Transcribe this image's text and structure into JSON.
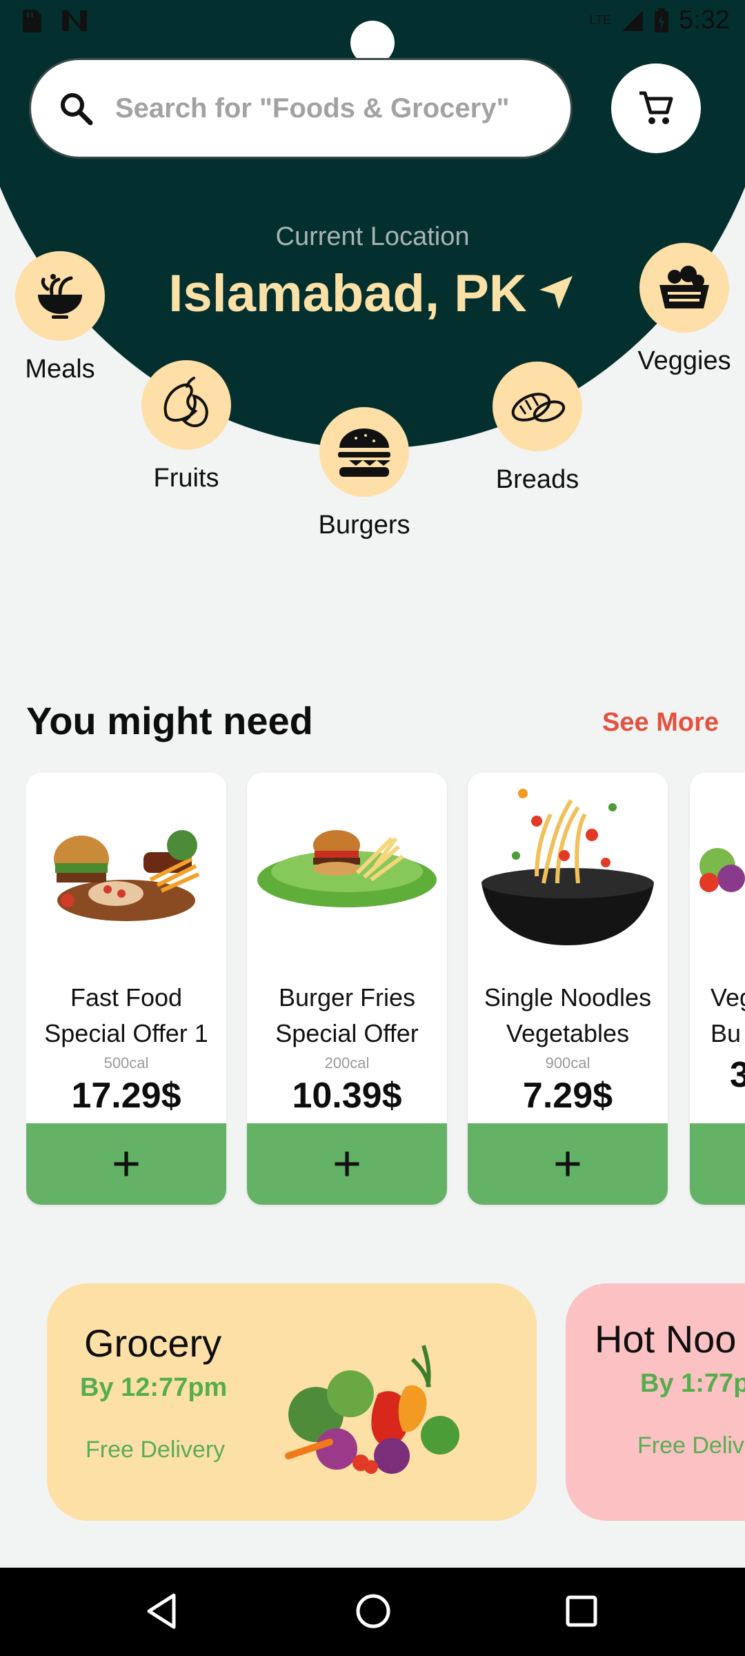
{
  "status": {
    "network": "LTE",
    "time": "5:32"
  },
  "search": {
    "placeholder": "Search for \"Foods & Grocery\""
  },
  "location": {
    "label": "Current Location",
    "value": "Islamabad, PK"
  },
  "categories": [
    {
      "label": "Meals",
      "icon": "meal-bowl-icon"
    },
    {
      "label": "Fruits",
      "icon": "fruits-icon"
    },
    {
      "label": "Burgers",
      "icon": "burger-icon"
    },
    {
      "label": "Breads",
      "icon": "bread-icon"
    },
    {
      "label": "Veggies",
      "icon": "veggies-basket-icon"
    }
  ],
  "section": {
    "title": "You might need",
    "see_more": "See More"
  },
  "products": [
    {
      "name_line1": "Fast Food",
      "name_line2": "Special Offer 1",
      "cal": "500cal",
      "price": "17.29$",
      "add": "+"
    },
    {
      "name_line1": "Burger Fries",
      "name_line2": "Special Offer",
      "cal": "200cal",
      "price": "10.39$",
      "add": "+"
    },
    {
      "name_line1": "Single Noodles",
      "name_line2": "Vegetables",
      "cal": "900cal",
      "price": "7.29$",
      "add": "+"
    },
    {
      "name_line1": "Veg",
      "name_line2": "Bu",
      "cal": "",
      "price": "3",
      "add": "+"
    }
  ],
  "promos": [
    {
      "title": "Grocery",
      "time": "By 12:77pm",
      "delivery": "Free Delivery",
      "color": "#fde0a6"
    },
    {
      "title": "Hot Noo",
      "time": "By 1:77p",
      "delivery": "Free Deliv",
      "color": "#fcc1c3"
    }
  ],
  "colors": {
    "hero": "#03302e",
    "accent": "#fbe1a6",
    "green": "#63b265",
    "see_more": "#e4513f"
  }
}
